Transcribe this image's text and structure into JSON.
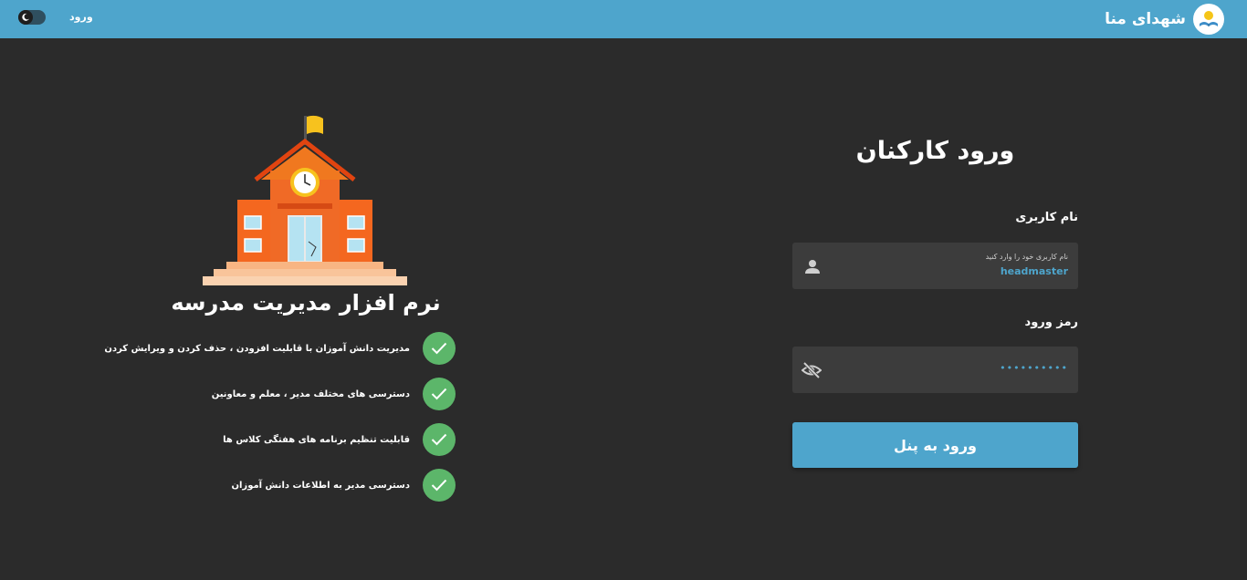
{
  "header": {
    "brand_name": "شهدای منا",
    "login_link": "ورود",
    "logo_icon": "school-book-logo-icon",
    "theme_toggle_icon": "moon-icon",
    "background_color": "#4ea5cc"
  },
  "login": {
    "title": "ورود کارکنان",
    "username_label": "نام کاربری",
    "username_caption": "نام کاربری خود را وارد کنید",
    "username_value": "headmaster",
    "username_icon": "person-icon",
    "password_label": "رمز ورود",
    "password_value": "••••••••••",
    "password_icon": "eye-off-icon",
    "submit_label": "ورود به پنل",
    "accent_color": "#4ea5cc"
  },
  "intro": {
    "headline": "نرم افزار مدیریت مدرسه",
    "illustration_icon": "school-building-icon",
    "features": [
      "مدیریت دانش آموزان با قابلیت افزودن ، حذف کردن و ویرایش کردن",
      "دسترسی های مختلف مدیر ، معلم و معاونین",
      "قابلیت تنظیم برنامه های هفتگی کلاس ها",
      "دسترسی مدیر به اطلاعات دانش آموزان"
    ],
    "check_icon": "check-icon",
    "check_color": "#5cb66a"
  }
}
